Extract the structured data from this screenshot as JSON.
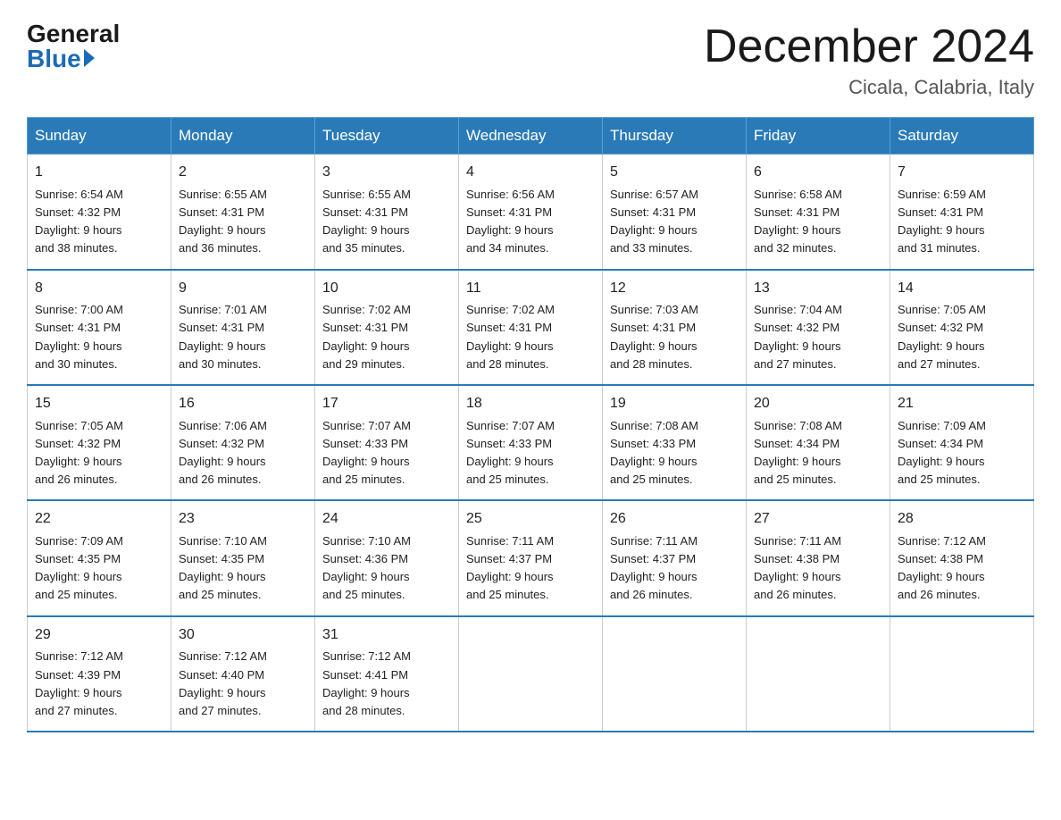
{
  "header": {
    "logo_general": "General",
    "logo_blue": "Blue",
    "month_title": "December 2024",
    "location": "Cicala, Calabria, Italy"
  },
  "weekdays": [
    "Sunday",
    "Monday",
    "Tuesday",
    "Wednesday",
    "Thursday",
    "Friday",
    "Saturday"
  ],
  "weeks": [
    [
      {
        "num": "1",
        "sunrise": "6:54 AM",
        "sunset": "4:32 PM",
        "daylight": "9 hours and 38 minutes."
      },
      {
        "num": "2",
        "sunrise": "6:55 AM",
        "sunset": "4:31 PM",
        "daylight": "9 hours and 36 minutes."
      },
      {
        "num": "3",
        "sunrise": "6:55 AM",
        "sunset": "4:31 PM",
        "daylight": "9 hours and 35 minutes."
      },
      {
        "num": "4",
        "sunrise": "6:56 AM",
        "sunset": "4:31 PM",
        "daylight": "9 hours and 34 minutes."
      },
      {
        "num": "5",
        "sunrise": "6:57 AM",
        "sunset": "4:31 PM",
        "daylight": "9 hours and 33 minutes."
      },
      {
        "num": "6",
        "sunrise": "6:58 AM",
        "sunset": "4:31 PM",
        "daylight": "9 hours and 32 minutes."
      },
      {
        "num": "7",
        "sunrise": "6:59 AM",
        "sunset": "4:31 PM",
        "daylight": "9 hours and 31 minutes."
      }
    ],
    [
      {
        "num": "8",
        "sunrise": "7:00 AM",
        "sunset": "4:31 PM",
        "daylight": "9 hours and 30 minutes."
      },
      {
        "num": "9",
        "sunrise": "7:01 AM",
        "sunset": "4:31 PM",
        "daylight": "9 hours and 30 minutes."
      },
      {
        "num": "10",
        "sunrise": "7:02 AM",
        "sunset": "4:31 PM",
        "daylight": "9 hours and 29 minutes."
      },
      {
        "num": "11",
        "sunrise": "7:02 AM",
        "sunset": "4:31 PM",
        "daylight": "9 hours and 28 minutes."
      },
      {
        "num": "12",
        "sunrise": "7:03 AM",
        "sunset": "4:31 PM",
        "daylight": "9 hours and 28 minutes."
      },
      {
        "num": "13",
        "sunrise": "7:04 AM",
        "sunset": "4:32 PM",
        "daylight": "9 hours and 27 minutes."
      },
      {
        "num": "14",
        "sunrise": "7:05 AM",
        "sunset": "4:32 PM",
        "daylight": "9 hours and 27 minutes."
      }
    ],
    [
      {
        "num": "15",
        "sunrise": "7:05 AM",
        "sunset": "4:32 PM",
        "daylight": "9 hours and 26 minutes."
      },
      {
        "num": "16",
        "sunrise": "7:06 AM",
        "sunset": "4:32 PM",
        "daylight": "9 hours and 26 minutes."
      },
      {
        "num": "17",
        "sunrise": "7:07 AM",
        "sunset": "4:33 PM",
        "daylight": "9 hours and 25 minutes."
      },
      {
        "num": "18",
        "sunrise": "7:07 AM",
        "sunset": "4:33 PM",
        "daylight": "9 hours and 25 minutes."
      },
      {
        "num": "19",
        "sunrise": "7:08 AM",
        "sunset": "4:33 PM",
        "daylight": "9 hours and 25 minutes."
      },
      {
        "num": "20",
        "sunrise": "7:08 AM",
        "sunset": "4:34 PM",
        "daylight": "9 hours and 25 minutes."
      },
      {
        "num": "21",
        "sunrise": "7:09 AM",
        "sunset": "4:34 PM",
        "daylight": "9 hours and 25 minutes."
      }
    ],
    [
      {
        "num": "22",
        "sunrise": "7:09 AM",
        "sunset": "4:35 PM",
        "daylight": "9 hours and 25 minutes."
      },
      {
        "num": "23",
        "sunrise": "7:10 AM",
        "sunset": "4:35 PM",
        "daylight": "9 hours and 25 minutes."
      },
      {
        "num": "24",
        "sunrise": "7:10 AM",
        "sunset": "4:36 PM",
        "daylight": "9 hours and 25 minutes."
      },
      {
        "num": "25",
        "sunrise": "7:11 AM",
        "sunset": "4:37 PM",
        "daylight": "9 hours and 25 minutes."
      },
      {
        "num": "26",
        "sunrise": "7:11 AM",
        "sunset": "4:37 PM",
        "daylight": "9 hours and 26 minutes."
      },
      {
        "num": "27",
        "sunrise": "7:11 AM",
        "sunset": "4:38 PM",
        "daylight": "9 hours and 26 minutes."
      },
      {
        "num": "28",
        "sunrise": "7:12 AM",
        "sunset": "4:38 PM",
        "daylight": "9 hours and 26 minutes."
      }
    ],
    [
      {
        "num": "29",
        "sunrise": "7:12 AM",
        "sunset": "4:39 PM",
        "daylight": "9 hours and 27 minutes."
      },
      {
        "num": "30",
        "sunrise": "7:12 AM",
        "sunset": "4:40 PM",
        "daylight": "9 hours and 27 minutes."
      },
      {
        "num": "31",
        "sunrise": "7:12 AM",
        "sunset": "4:41 PM",
        "daylight": "9 hours and 28 minutes."
      },
      null,
      null,
      null,
      null
    ]
  ],
  "labels": {
    "sunrise": "Sunrise:",
    "sunset": "Sunset:",
    "daylight": "Daylight:"
  }
}
